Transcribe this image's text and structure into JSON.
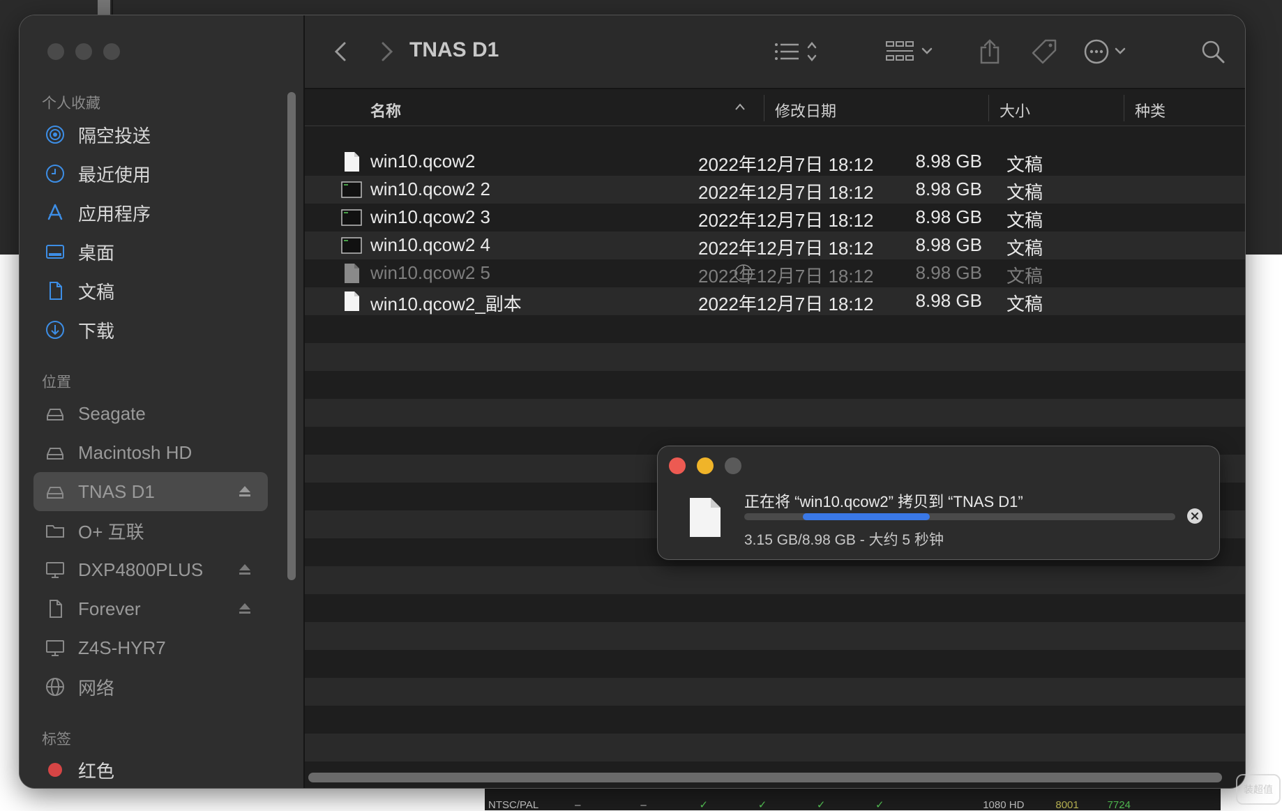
{
  "window": {
    "title": "TNAS D1"
  },
  "sidebar": {
    "favorites_label": "个人收藏",
    "favorites": [
      {
        "label": "隔空投送",
        "icon": "airdrop-icon"
      },
      {
        "label": "最近使用",
        "icon": "clock-icon"
      },
      {
        "label": "应用程序",
        "icon": "apps-icon"
      },
      {
        "label": "桌面",
        "icon": "desktop-icon"
      },
      {
        "label": "文稿",
        "icon": "document-icon"
      },
      {
        "label": "下载",
        "icon": "download-icon"
      }
    ],
    "locations_label": "位置",
    "locations": [
      {
        "label": "Seagate",
        "icon": "drive-icon"
      },
      {
        "label": "Macintosh HD",
        "icon": "drive-icon"
      },
      {
        "label": "TNAS D1",
        "icon": "drive-icon",
        "selected": true,
        "eject": true
      },
      {
        "label": "O+ 互联",
        "icon": "folder-icon"
      },
      {
        "label": "DXP4800PLUS",
        "icon": "monitor-icon",
        "eject": true
      },
      {
        "label": "Forever",
        "icon": "document-icon",
        "eject": true
      },
      {
        "label": "Z4S-HYR7",
        "icon": "monitor-icon"
      },
      {
        "label": "网络",
        "icon": "globe-icon"
      }
    ],
    "tags_label": "标签",
    "tags": [
      {
        "label": "红色",
        "color": "#d64545"
      }
    ]
  },
  "columns": {
    "name": "名称",
    "date": "修改日期",
    "size": "大小",
    "kind": "种类"
  },
  "files": [
    {
      "name": "win10.qcow2",
      "date": "2022年12月7日 18:12",
      "size": "8.98 GB",
      "kind": "文稿",
      "icon": "document-icon"
    },
    {
      "name": "win10.qcow2 2",
      "date": "2022年12月7日 18:12",
      "size": "8.98 GB",
      "kind": "文稿",
      "icon": "terminal-icon"
    },
    {
      "name": "win10.qcow2 3",
      "date": "2022年12月7日 18:12",
      "size": "8.98 GB",
      "kind": "文稿",
      "icon": "terminal-icon"
    },
    {
      "name": "win10.qcow2 4",
      "date": "2022年12月7日 18:12",
      "size": "8.98 GB",
      "kind": "文稿",
      "icon": "terminal-icon"
    },
    {
      "name": "win10.qcow2 5",
      "date": "2022年12月7日 18:12",
      "size": "8.98 GB",
      "kind": "文稿",
      "icon": "document-icon",
      "pending": true
    },
    {
      "name": "win10.qcow2_副本",
      "date": "2022年12月7日 18:12",
      "size": "8.98 GB",
      "kind": "文稿",
      "icon": "document-icon"
    }
  ],
  "copy_dialog": {
    "title": "正在将 “win10.qcow2” 拷贝到 “TNAS D1”",
    "status": "3.15 GB/8.98 GB - 大约 5 秒钟",
    "progress": 0.35,
    "colors": {
      "close": "#ed5a52",
      "minimize": "#f0b429",
      "zoom": "#5a5a5a",
      "progress": "#3a78e6"
    }
  },
  "background": {
    "row_labels": [
      "NTSC/PAL",
      "–",
      "–",
      "✓",
      "✓",
      "✓",
      "✓",
      "1080 HD",
      "8001",
      "7724"
    ]
  },
  "watermark": "装超值"
}
